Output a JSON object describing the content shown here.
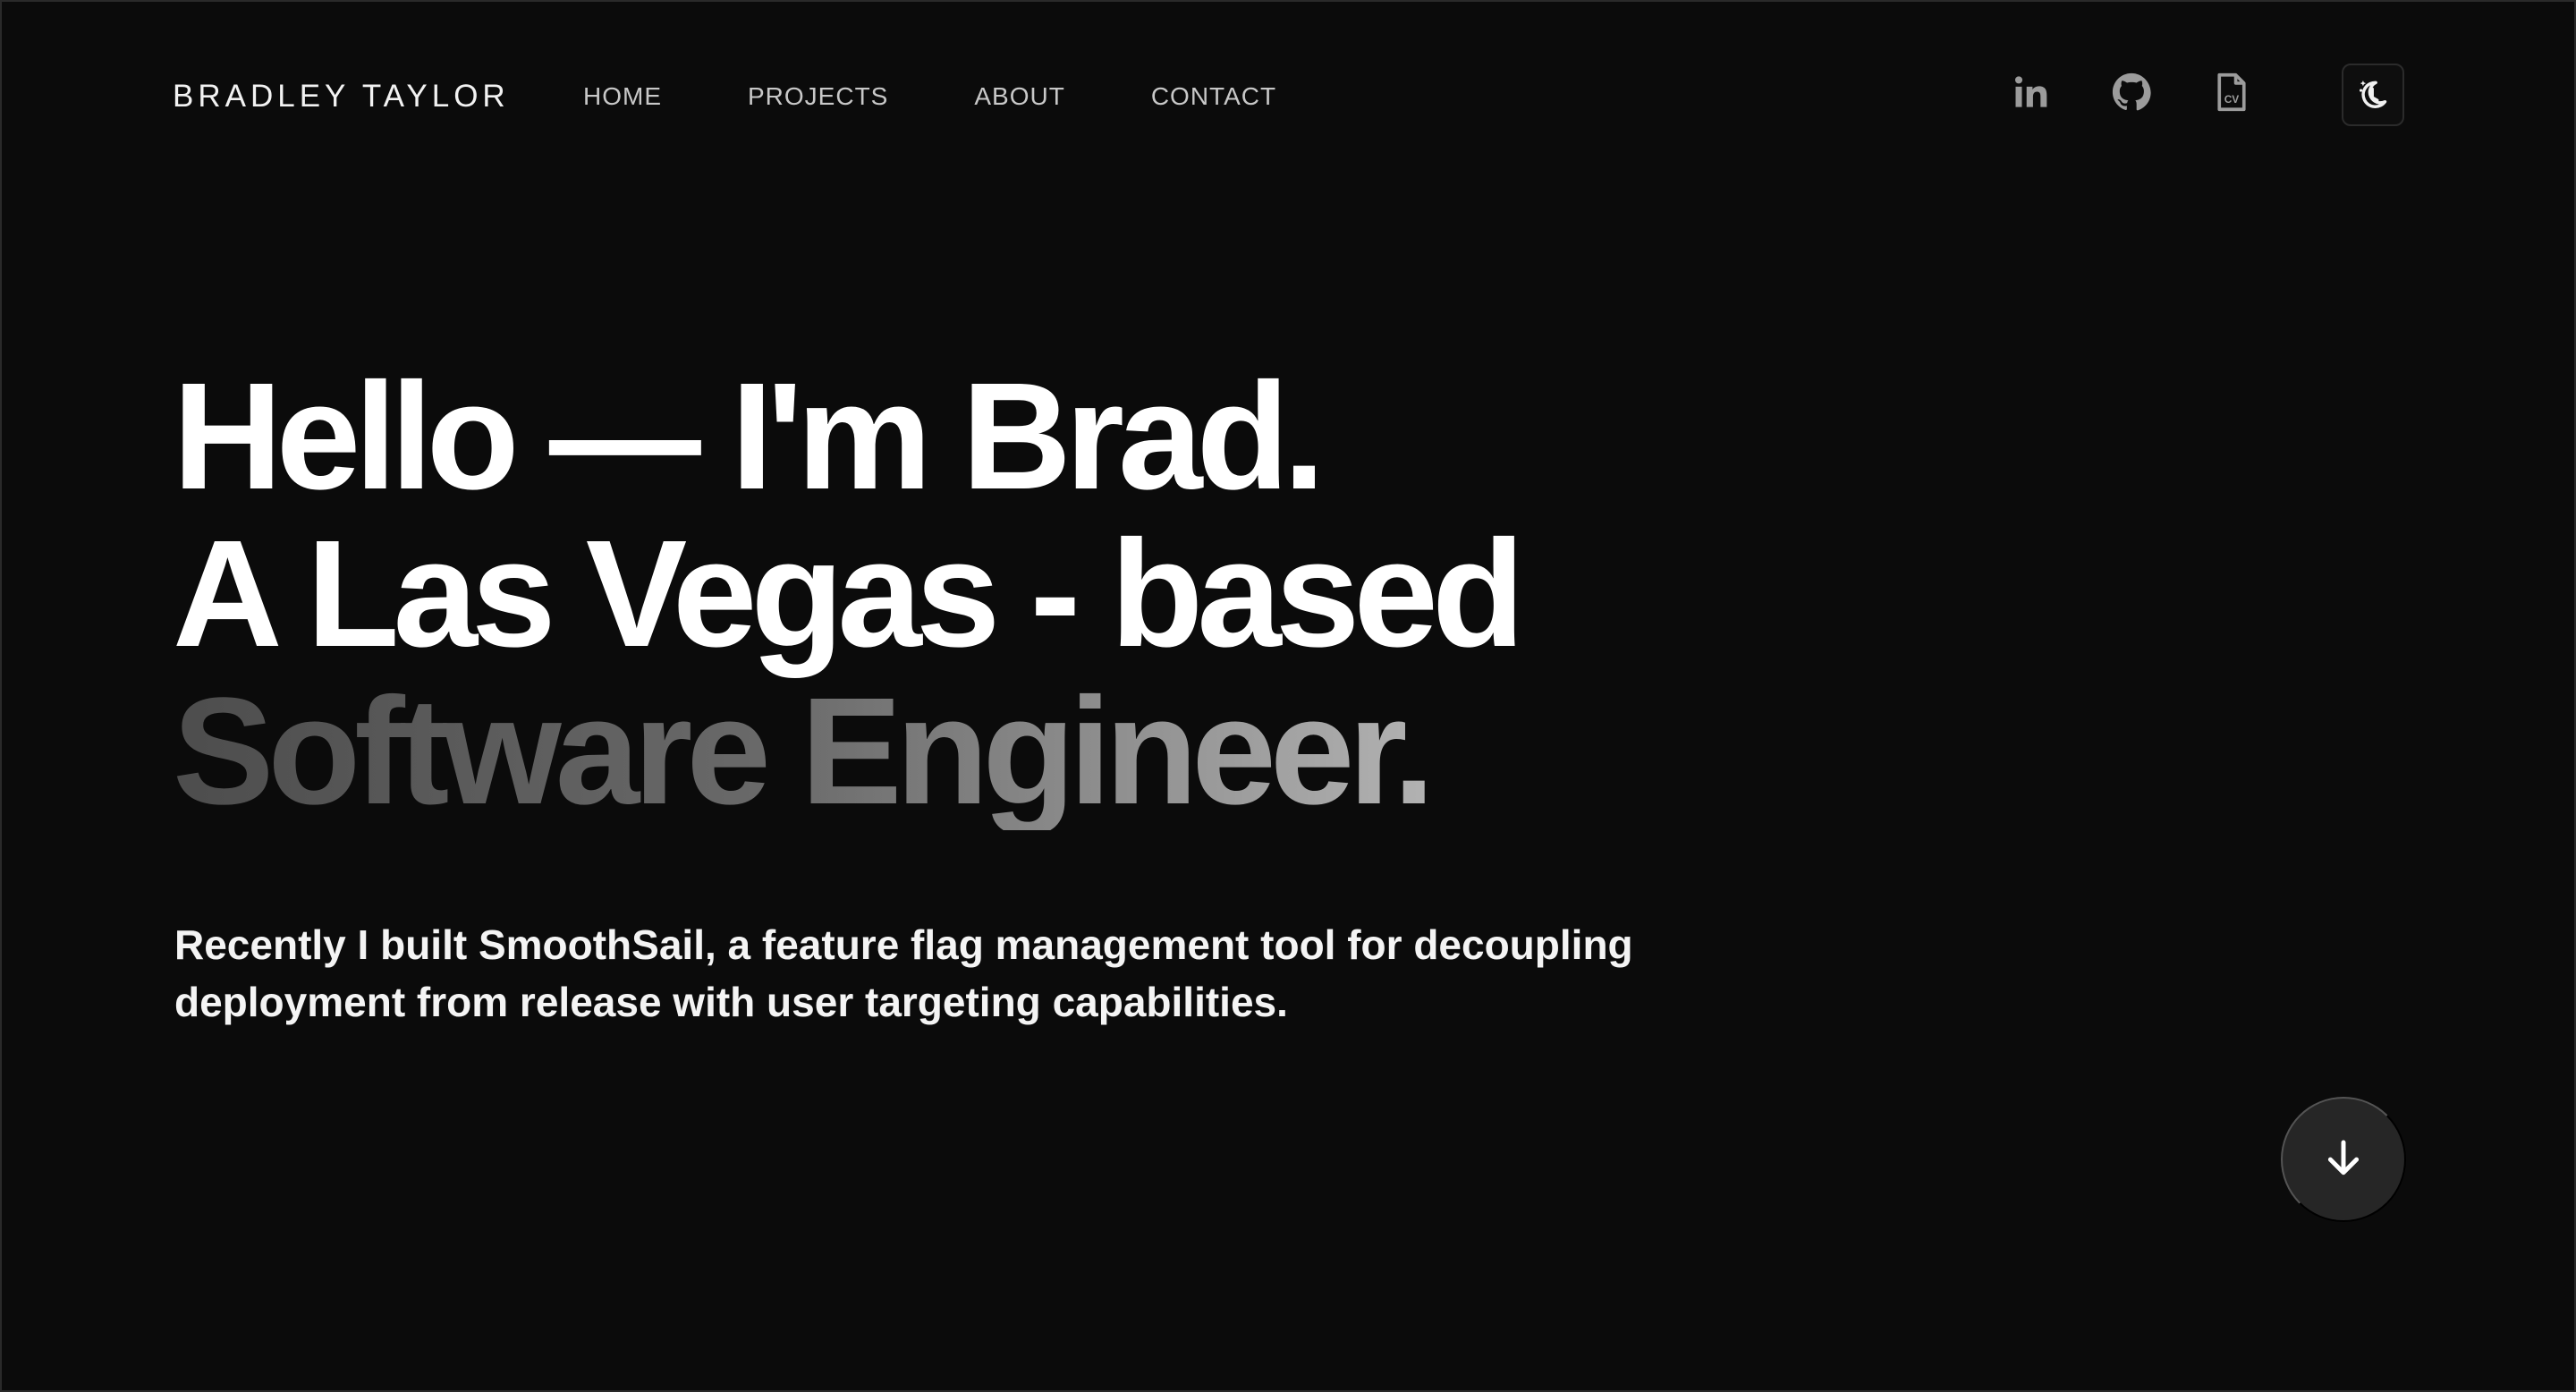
{
  "brand": "BRADLEY TAYLOR",
  "nav": {
    "items": [
      {
        "label": "HOME"
      },
      {
        "label": "PROJECTS"
      },
      {
        "label": "ABOUT"
      },
      {
        "label": "CONTACT"
      }
    ]
  },
  "social": {
    "icons": [
      "linkedin-icon",
      "github-icon",
      "cv-document-icon"
    ],
    "cv_label": "CV"
  },
  "theme_toggle": {
    "icon": "moon-stars-icon"
  },
  "hero": {
    "line1": "Hello — I'm Brad.",
    "line2": "A Las Vegas - based",
    "line3": "Software Engineer."
  },
  "intro": "Recently I built SmoothSail, a feature flag management tool for decoupling deployment from release with user targeting capabilities.",
  "scroll_button": {
    "icon": "arrow-down-icon"
  },
  "colors": {
    "background": "#0b0b0b",
    "text": "#ffffff",
    "nav_text": "#c8c8c8",
    "icon": "#9c9c9c",
    "button_bg": "#262626"
  }
}
